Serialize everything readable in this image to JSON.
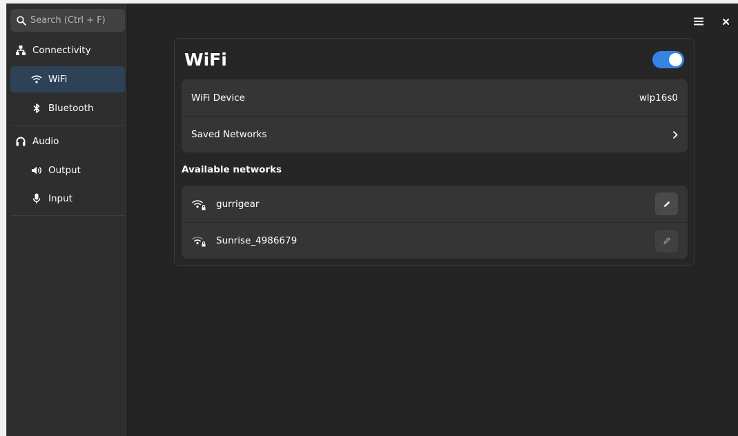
{
  "sidebar": {
    "search_placeholder": "Search (Ctrl + F)",
    "items": [
      {
        "label": "Connectivity",
        "icon": "network-icon"
      },
      {
        "label": "WiFi",
        "icon": "wifi-icon"
      },
      {
        "label": "Bluetooth",
        "icon": "bluetooth-icon"
      },
      {
        "label": "Audio",
        "icon": "headphones-icon"
      },
      {
        "label": "Output",
        "icon": "speaker-icon"
      },
      {
        "label": "Input",
        "icon": "microphone-icon"
      }
    ],
    "selected": "WiFi"
  },
  "header": {
    "menu_icon": "hamburger-menu-icon",
    "close_icon": "close-icon"
  },
  "main": {
    "title": "WiFi",
    "wifi_enabled": true,
    "device_label": "WiFi Device",
    "device_value": "wlp16s0",
    "saved_networks_label": "Saved Networks",
    "available_title": "Available networks",
    "networks": [
      {
        "ssid": "gurrigear",
        "secured": true
      },
      {
        "ssid": "Sunrise_4986679",
        "secured": true
      }
    ]
  },
  "colors": {
    "accent": "#3584e4",
    "window_bg": "#242424",
    "sidebar_bg": "#2e2e2e",
    "selected_bg": "#2e4257",
    "card_bg": "#353535"
  }
}
